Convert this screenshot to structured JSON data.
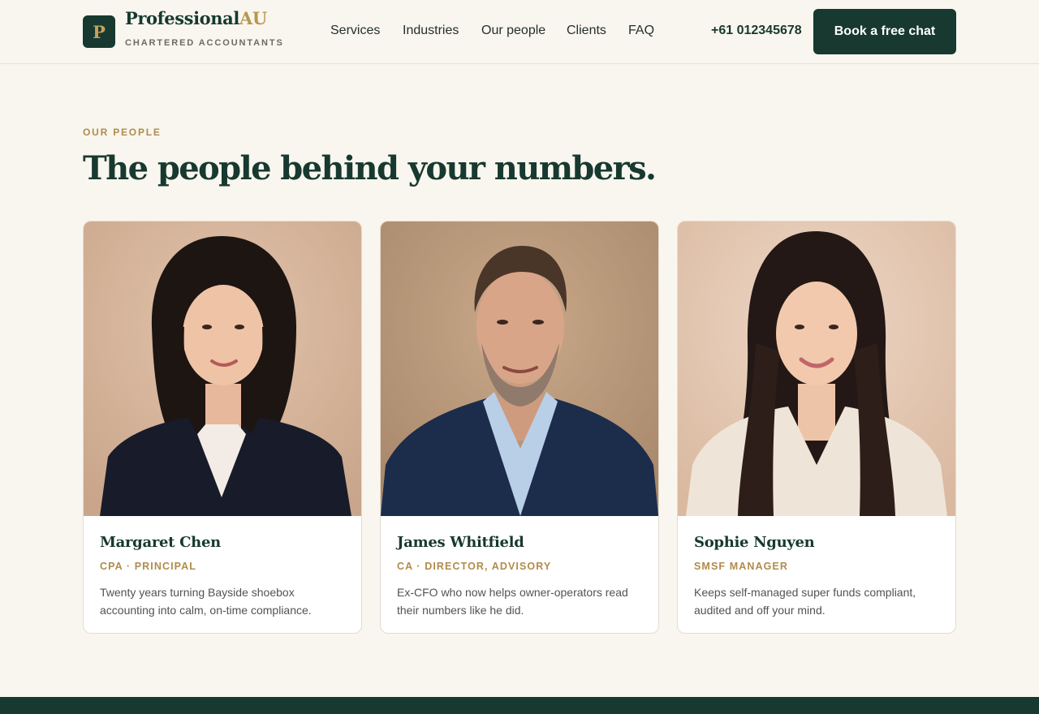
{
  "brand": {
    "logo_letter": "P",
    "name_primary": "Professional",
    "name_accent": "AU",
    "tagline": "CHARTERED ACCOUNTANTS"
  },
  "nav": {
    "items": [
      {
        "label": "Services"
      },
      {
        "label": "Industries"
      },
      {
        "label": "Our people"
      },
      {
        "label": "Clients"
      },
      {
        "label": "FAQ"
      }
    ],
    "phone": "+61 012345678",
    "cta_label": "Book a free chat"
  },
  "section": {
    "eyebrow": "OUR PEOPLE",
    "title": "The people behind your numbers."
  },
  "people": [
    {
      "name": "Margaret Chen",
      "role": "CPA · PRINCIPAL",
      "bio": "Twenty years turning Bayside shoebox accounting into calm, on-time compliance."
    },
    {
      "name": "James Whitfield",
      "role": "CA · DIRECTOR, ADVISORY",
      "bio": "Ex-CFO who now helps owner-operators read their numbers like he did."
    },
    {
      "name": "Sophie Nguyen",
      "role": "SMSF MANAGER",
      "bio": "Keeps self-managed super funds compliant, audited and off your mind."
    }
  ],
  "colors": {
    "brand_dark": "#17392f",
    "brand_gold": "#b8964f",
    "background": "#f9f6ef"
  }
}
